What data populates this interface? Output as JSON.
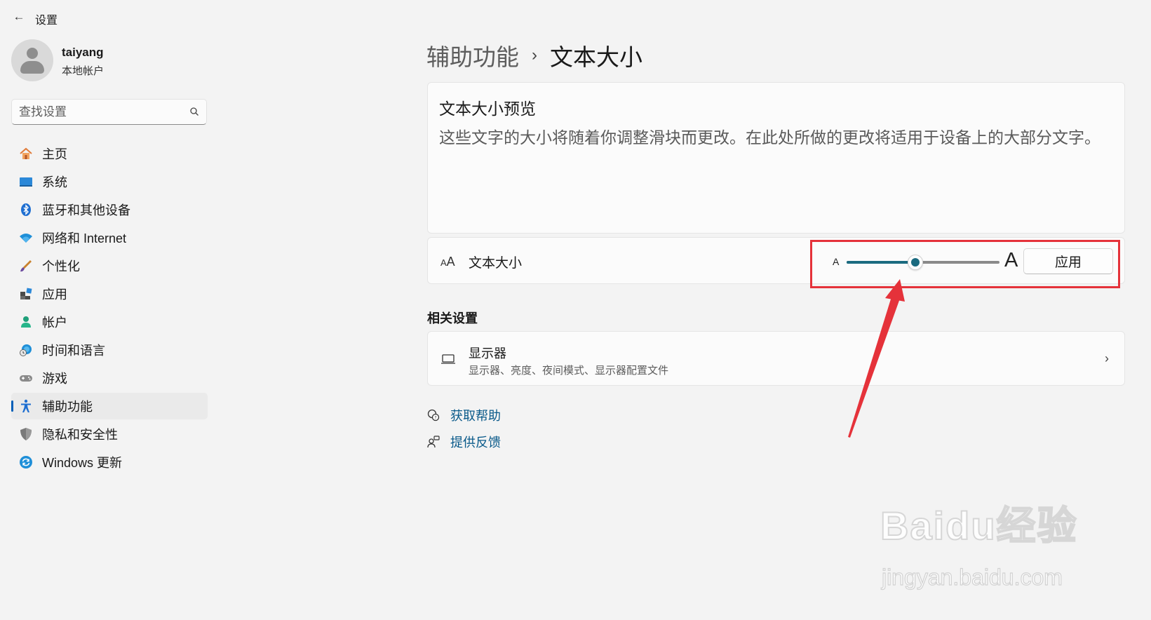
{
  "window": {
    "title": "设置",
    "back_icon": "←"
  },
  "profile": {
    "name": "taiyang",
    "account_type": "本地帐户"
  },
  "search": {
    "placeholder": "查找设置"
  },
  "sidebar": {
    "items": [
      {
        "label": "主页",
        "icon": "home-icon",
        "selected": false
      },
      {
        "label": "系统",
        "icon": "system-icon",
        "selected": false
      },
      {
        "label": "蓝牙和其他设备",
        "icon": "bluetooth-icon",
        "selected": false
      },
      {
        "label": "网络和 Internet",
        "icon": "wifi-icon",
        "selected": false
      },
      {
        "label": "个性化",
        "icon": "brush-icon",
        "selected": false
      },
      {
        "label": "应用",
        "icon": "apps-icon",
        "selected": false
      },
      {
        "label": "帐户",
        "icon": "account-icon",
        "selected": false
      },
      {
        "label": "时间和语言",
        "icon": "globe-clock-icon",
        "selected": false
      },
      {
        "label": "游戏",
        "icon": "gamepad-icon",
        "selected": false
      },
      {
        "label": "辅助功能",
        "icon": "accessibility-icon",
        "selected": true
      },
      {
        "label": "隐私和安全性",
        "icon": "shield-icon",
        "selected": false
      },
      {
        "label": "Windows 更新",
        "icon": "update-icon",
        "selected": false
      }
    ]
  },
  "breadcrumb": {
    "parent": "辅助功能",
    "separator": "›",
    "current": "文本大小"
  },
  "preview": {
    "title": "文本大小预览",
    "text": "这些文字的大小将随着你调整滑块而更改。在此处所做的更改将适用于设备上的大部分文字。"
  },
  "text_size": {
    "label": "文本大小",
    "icon_small": "A",
    "icon_big": "A",
    "slider_min_label": "A",
    "slider_max_label": "A",
    "slider_value_fraction": 0.45,
    "apply_label": "应用"
  },
  "related": {
    "header": "相关设置",
    "display": {
      "title": "显示器",
      "subtitle": "显示器、亮度、夜间模式、显示器配置文件",
      "chevron": "›"
    }
  },
  "links": {
    "help": "获取帮助",
    "feedback": "提供反馈"
  },
  "watermark": {
    "logo": "Baidu经验",
    "url": "jingyan.baidu.com"
  },
  "colors": {
    "accent": "#1b6b80",
    "highlight": "#e5323a",
    "link": "#0a5a8a",
    "background": "#f3f3f3",
    "card": "#fbfbfb"
  }
}
